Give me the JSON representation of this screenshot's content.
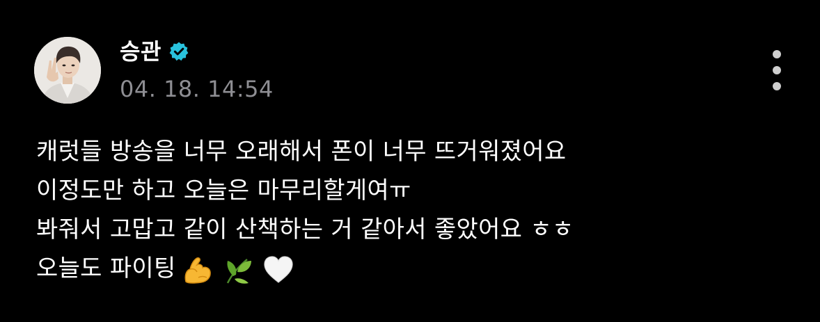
{
  "post": {
    "author": {
      "name": "승관",
      "verified": true,
      "avatar": "profile-photo"
    },
    "timestamp": "04. 18. 14:54",
    "more_menu_icon": "more-vertical-icon",
    "lines": [
      "캐럿들 방송을 너무 오래해서 폰이 너무 뜨거워졌어요",
      "이정도만 하고 오늘은 마무리할게여ㅠ",
      "봐줘서 고맙고 같이 산책하는 거 같아서 좋았어요 ㅎㅎ",
      "오늘도 파이팅"
    ],
    "emojis": [
      "flexed-biceps-emoji",
      "herb-emoji",
      "white-heart-emoji"
    ]
  },
  "colors": {
    "background": "#000000",
    "text": "#ffffff",
    "muted": "#8e8e93",
    "verified_badge": "#29c2dd",
    "menu_dots": "#cfcfcf"
  }
}
